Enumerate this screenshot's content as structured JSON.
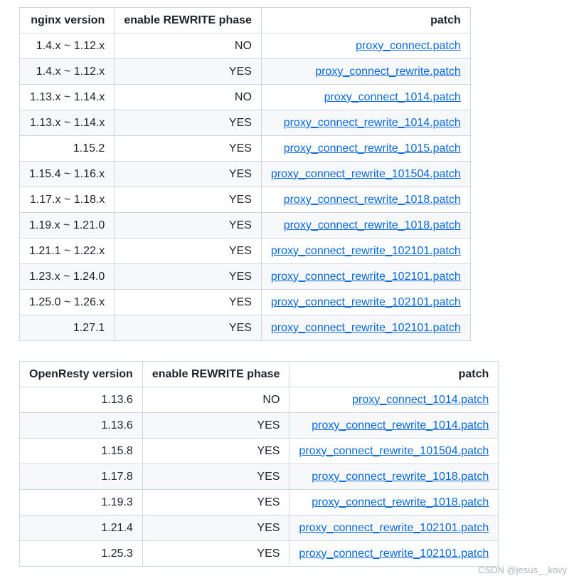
{
  "nginx_table": {
    "headers": [
      "nginx version",
      "enable REWRITE phase",
      "patch"
    ],
    "rows": [
      {
        "version": "1.4.x ~ 1.12.x",
        "rewrite": "NO",
        "patch": "proxy_connect.patch"
      },
      {
        "version": "1.4.x ~ 1.12.x",
        "rewrite": "YES",
        "patch": "proxy_connect_rewrite.patch"
      },
      {
        "version": "1.13.x ~ 1.14.x",
        "rewrite": "NO",
        "patch": "proxy_connect_1014.patch"
      },
      {
        "version": "1.13.x ~ 1.14.x",
        "rewrite": "YES",
        "patch": "proxy_connect_rewrite_1014.patch"
      },
      {
        "version": "1.15.2",
        "rewrite": "YES",
        "patch": "proxy_connect_rewrite_1015.patch"
      },
      {
        "version": "1.15.4 ~ 1.16.x",
        "rewrite": "YES",
        "patch": "proxy_connect_rewrite_101504.patch"
      },
      {
        "version": "1.17.x ~ 1.18.x",
        "rewrite": "YES",
        "patch": "proxy_connect_rewrite_1018.patch"
      },
      {
        "version": "1.19.x ~ 1.21.0",
        "rewrite": "YES",
        "patch": "proxy_connect_rewrite_1018.patch"
      },
      {
        "version": "1.21.1 ~ 1.22.x",
        "rewrite": "YES",
        "patch": "proxy_connect_rewrite_102101.patch"
      },
      {
        "version": "1.23.x ~ 1.24.0",
        "rewrite": "YES",
        "patch": "proxy_connect_rewrite_102101.patch"
      },
      {
        "version": "1.25.0 ~ 1.26.x",
        "rewrite": "YES",
        "patch": "proxy_connect_rewrite_102101.patch"
      },
      {
        "version": "1.27.1",
        "rewrite": "YES",
        "patch": "proxy_connect_rewrite_102101.patch"
      }
    ]
  },
  "openresty_table": {
    "headers": [
      "OpenResty version",
      "enable REWRITE phase",
      "patch"
    ],
    "rows": [
      {
        "version": "1.13.6",
        "rewrite": "NO",
        "patch": "proxy_connect_1014.patch"
      },
      {
        "version": "1.13.6",
        "rewrite": "YES",
        "patch": "proxy_connect_rewrite_1014.patch"
      },
      {
        "version": "1.15.8",
        "rewrite": "YES",
        "patch": "proxy_connect_rewrite_101504.patch"
      },
      {
        "version": "1.17.8",
        "rewrite": "YES",
        "patch": "proxy_connect_rewrite_1018.patch"
      },
      {
        "version": "1.19.3",
        "rewrite": "YES",
        "patch": "proxy_connect_rewrite_1018.patch"
      },
      {
        "version": "1.21.4",
        "rewrite": "YES",
        "patch": "proxy_connect_rewrite_102101.patch"
      },
      {
        "version": "1.25.3",
        "rewrite": "YES",
        "patch": "proxy_connect_rewrite_102101.patch"
      }
    ]
  },
  "watermark": "CSDN @jesus__kovy",
  "colors": {
    "link": "#0969da",
    "border": "#d0d7de",
    "stripe": "#f6f8fa"
  }
}
